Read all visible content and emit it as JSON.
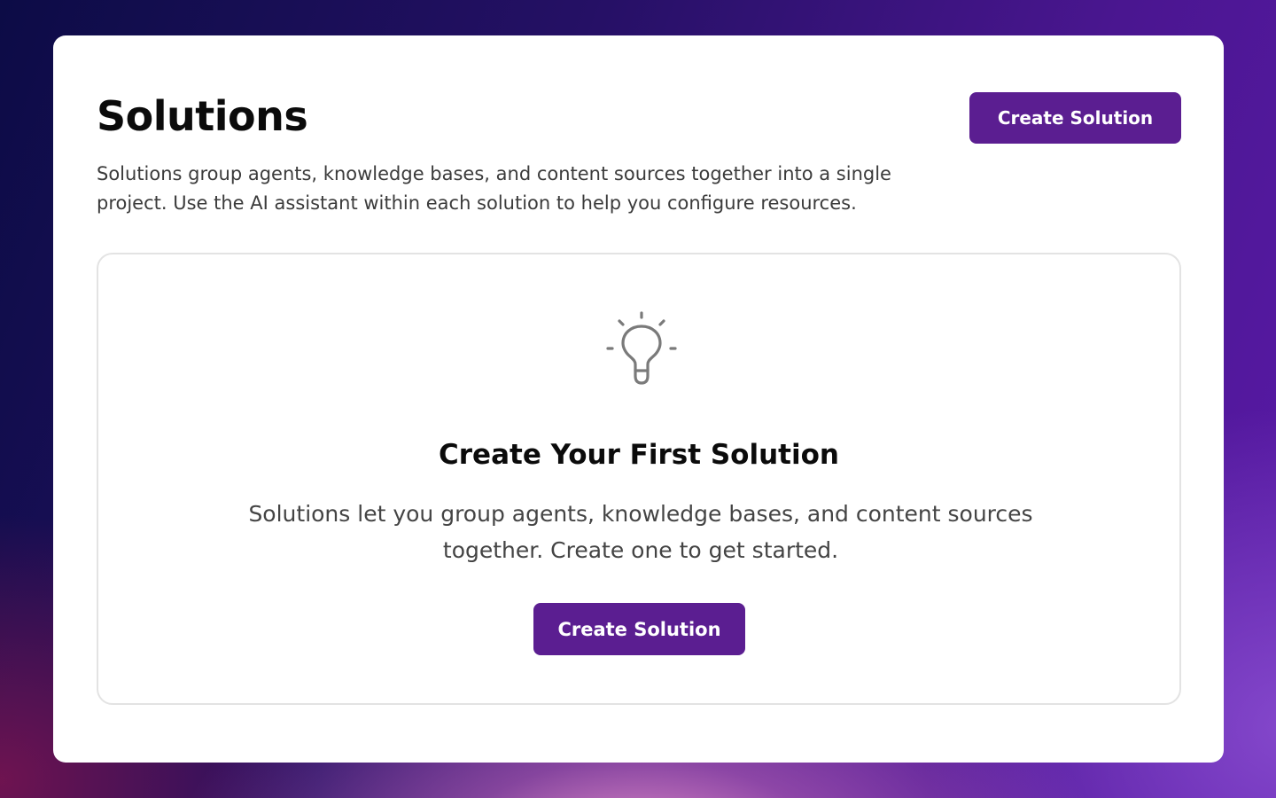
{
  "header": {
    "title": "Solutions",
    "create_button_label": "Create Solution",
    "description": "Solutions group agents, knowledge bases, and content sources together into a single project. Use the AI assistant within each solution to help you configure resources."
  },
  "empty_state": {
    "icon": "lightbulb-icon",
    "title": "Create Your First Solution",
    "text": "Solutions let you group agents, knowledge bases, and content sources together. Create one to get started.",
    "button_label": "Create Solution"
  },
  "colors": {
    "accent": "#5b1e91",
    "icon": "#7a7a7a"
  }
}
